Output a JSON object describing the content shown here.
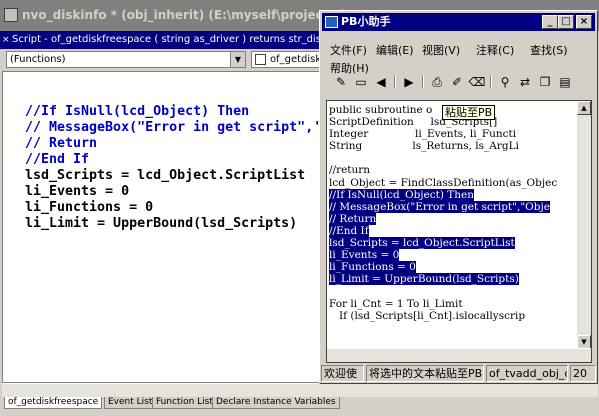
{
  "main_window": {
    "title": "nvo_diskinfo * (obj_inherit) (E:\\myself\\project\\pb..."
  },
  "script_bar": {
    "text": "Script - of_getdiskfreespace ( string as_driver ) returns str_diskspace"
  },
  "selectors": {
    "functions_value": "(Functions)",
    "event_value": "of_getdiskfrees"
  },
  "editor": {
    "lines": [
      {
        "text": "//If IsNull(lcd_Object) Then",
        "type": "cm"
      },
      {
        "text": "// MessageBox(\"Error in get script\",'",
        "type": "cm"
      },
      {
        "text": "// Return",
        "type": "cm"
      },
      {
        "text": "//End If",
        "type": "cm"
      },
      {
        "text": "lsd_Scripts = lcd_Object.ScriptList",
        "type": "co"
      },
      {
        "text": "li_Events = 0",
        "type": "co"
      },
      {
        "text": "li_Functions = 0",
        "type": "co"
      },
      {
        "text": "li_Limit = UpperBound(lsd_Scripts)",
        "type": "co"
      }
    ]
  },
  "bottom_tabs": [
    {
      "label": "of_getdiskfreespace",
      "active": true
    },
    {
      "label": "Event List",
      "active": false
    },
    {
      "label": "Function List",
      "active": false
    },
    {
      "label": "Declare Instance Variables",
      "active": false
    }
  ],
  "dialog": {
    "title": "PB小助手",
    "menus": [
      "文件(F)",
      "编辑(E)",
      "视图(V)",
      "注释(C)",
      "查找(S)",
      "帮助(H)"
    ],
    "toolbar_icons": [
      "wand-icon",
      "keyboard-icon",
      "step-back-icon",
      "separator",
      "play-stop-icon",
      "separator",
      "print-icon",
      "comment-icon",
      "erase-icon",
      "separator",
      "find-icon",
      "find-replace-icon",
      "copy-icon",
      "paste-icon"
    ],
    "code_lines": [
      {
        "text": "public subroutine o",
        "sel": false
      },
      {
        "text": "ScriptDefinition     lsd_Scripts[]",
        "sel": false
      },
      {
        "text": "Integer              li_Events, li_Functi",
        "sel": false
      },
      {
        "text": "String               ls_Returns, ls_ArgLi",
        "sel": false
      },
      {
        "text": "",
        "sel": false
      },
      {
        "text": "//return",
        "sel": false
      },
      {
        "text": "lcd_Object = FindClassDefinition(as_Objec",
        "sel": false
      },
      {
        "text": "//If IsNull(lcd_Object) Then",
        "sel": true
      },
      {
        "text": "// MessageBox(\"Error in get script\",\"Obje",
        "sel": true
      },
      {
        "text": "// Return",
        "sel": true
      },
      {
        "text": "//End If",
        "sel": true
      },
      {
        "text": "lsd_Scripts = lcd_Object.ScriptList",
        "sel": true
      },
      {
        "text": "li_Events = 0",
        "sel": true
      },
      {
        "text": "li_Functions = 0",
        "sel": true
      },
      {
        "text": "li_Limit = UpperBound(lsd_Scripts)",
        "sel": true
      },
      {
        "text": "",
        "sel": false
      },
      {
        "text": "For li_Cnt = 1 To li_Limit",
        "sel": false
      },
      {
        "text": "   If (lsd_Scripts[li_Cnt].islocallyscrip",
        "sel": false
      }
    ],
    "tooltip": "粘贴至PB",
    "status": [
      "欢迎使",
      "将选中的文本粘贴至PB",
      "of_tvadd_obj_c",
      "20"
    ]
  }
}
